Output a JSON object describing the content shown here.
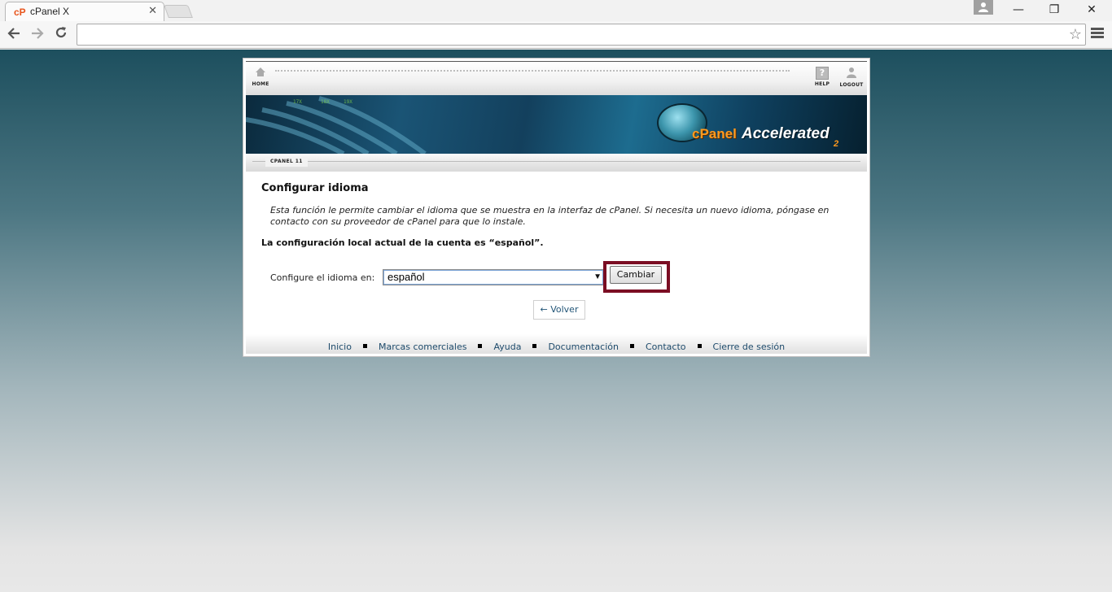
{
  "browser": {
    "tab_title": "cPanel X",
    "tab_favicon": "cP",
    "tab_close": "✕",
    "window_controls": {
      "minimize": "—",
      "restore": "❐",
      "close": "✕"
    },
    "address": ""
  },
  "cpanel": {
    "nav": {
      "home": "HOME",
      "help": "HELP",
      "logout": "LOGOUT"
    },
    "banner": {
      "brand": "cPanel",
      "tagline": "Accelerated",
      "version_mark": "2"
    },
    "version_label": "CPANEL 11",
    "page": {
      "title": "Configurar idioma",
      "description": "Esta función le permite cambiar el idioma que se muestra en la interfaz de cPanel. Si necesita un nuevo idioma, póngase en contacto con su proveedor de cPanel para que lo instale.",
      "current_locale": "La configuración local actual de la cuenta es “español”.",
      "select_label": "Configure el idioma en:",
      "selected_language": "español",
      "change_button": "Cambiar",
      "back_button": "← Volver"
    },
    "footer": [
      "Inicio",
      "Marcas comerciales",
      "Ayuda",
      "Documentación",
      "Contacto",
      "Cierre de sesión"
    ]
  },
  "colors": {
    "highlight_border": "#7b0d23",
    "footer_link": "#1d4a6b",
    "brand_orange": "#ff9a1f"
  },
  "icons": [
    "cpanel-favicon-icon",
    "close-icon",
    "user-icon",
    "minimize-icon",
    "restore-icon",
    "back-arrow-icon",
    "forward-arrow-icon",
    "reload-icon",
    "star-icon",
    "menu-icon",
    "home-icon",
    "help-icon",
    "logout-icon",
    "dropdown-arrow-icon"
  ]
}
